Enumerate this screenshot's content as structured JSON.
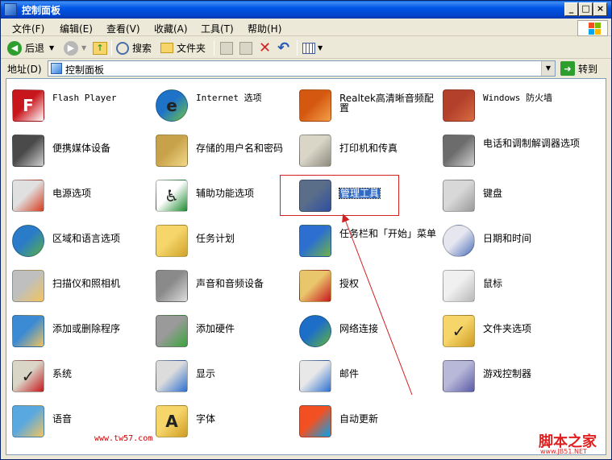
{
  "window": {
    "title": "控制面板"
  },
  "menubar": [
    "文件(F)",
    "编辑(E)",
    "查看(V)",
    "收藏(A)",
    "工具(T)",
    "帮助(H)"
  ],
  "toolbar": {
    "back": "后退",
    "search": "搜索",
    "folders": "文件夹"
  },
  "address": {
    "label": "地址(D)",
    "value": "控制面板",
    "go": "转到"
  },
  "items": [
    {
      "label": "Flash Player",
      "icon": "flash-icon"
    },
    {
      "label": "Internet 选项",
      "icon": "globe-icon"
    },
    {
      "label": "Realtek高清晰音频配置",
      "icon": "speaker-icon"
    },
    {
      "label": "Windows 防火墙",
      "icon": "firewall-icon"
    },
    {
      "label": "便携媒体设备",
      "icon": "media-device-icon"
    },
    {
      "label": "存储的用户名和密码",
      "icon": "keys-icon"
    },
    {
      "label": "打印机和传真",
      "icon": "printer-icon"
    },
    {
      "label": "电话和调制解调器选项",
      "icon": "phone-icon"
    },
    {
      "label": "电源选项",
      "icon": "power-icon"
    },
    {
      "label": "辅助功能选项",
      "icon": "accessibility-icon"
    },
    {
      "label": "管理工具",
      "icon": "admin-tools-icon"
    },
    {
      "label": "键盘",
      "icon": "keyboard-icon"
    },
    {
      "label": "区域和语言选项",
      "icon": "region-globe-icon"
    },
    {
      "label": "任务计划",
      "icon": "scheduled-tasks-icon"
    },
    {
      "label": "任务栏和「开始」菜单",
      "icon": "taskbar-icon"
    },
    {
      "label": "日期和时间",
      "icon": "clock-icon"
    },
    {
      "label": "扫描仪和照相机",
      "icon": "scanner-icon"
    },
    {
      "label": "声音和音频设备",
      "icon": "sound-icon"
    },
    {
      "label": "授权",
      "icon": "license-icon"
    },
    {
      "label": "鼠标",
      "icon": "mouse-icon"
    },
    {
      "label": "添加或删除程序",
      "icon": "add-remove-programs-icon"
    },
    {
      "label": "添加硬件",
      "icon": "add-hardware-icon"
    },
    {
      "label": "网络连接",
      "icon": "network-icon"
    },
    {
      "label": "文件夹选项",
      "icon": "folder-options-icon"
    },
    {
      "label": "系统",
      "icon": "system-icon"
    },
    {
      "label": "显示",
      "icon": "display-icon"
    },
    {
      "label": "邮件",
      "icon": "mail-icon"
    },
    {
      "label": "游戏控制器",
      "icon": "gamepad-icon"
    },
    {
      "label": "语音",
      "icon": "speech-icon"
    },
    {
      "label": "字体",
      "icon": "fonts-icon"
    },
    {
      "label": "自动更新",
      "icon": "windows-update-icon"
    }
  ],
  "watermarks": {
    "site": "www.tw57.com",
    "brand": "脚本之家",
    "brand_url": "www.JB51.NET"
  }
}
